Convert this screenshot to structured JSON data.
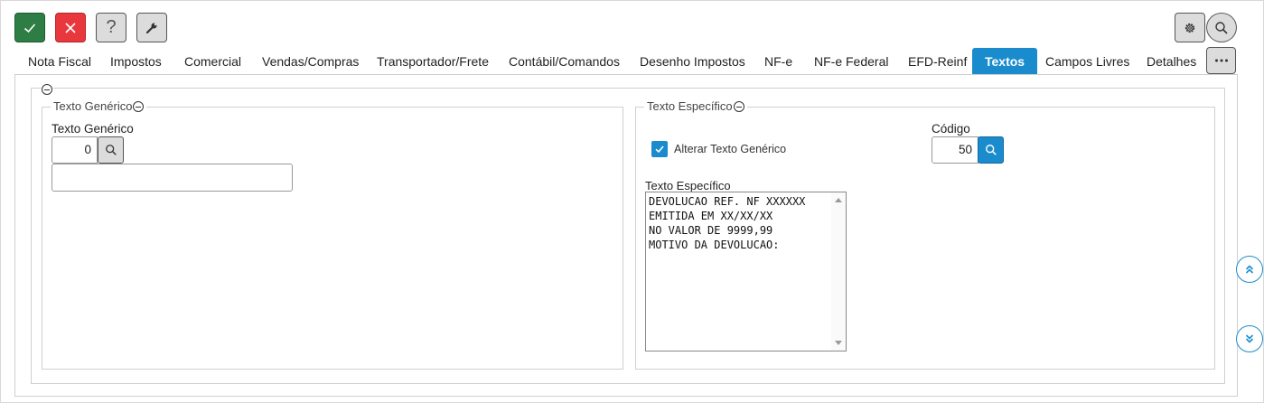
{
  "toolbar": {
    "confirm_icon": "check-icon",
    "cancel_icon": "close-icon",
    "help_label": "?",
    "tools_icon": "wrench-icon",
    "settings_icon": "gear-icon",
    "search_icon": "search-icon"
  },
  "tabs": [
    {
      "label": "Nota Fiscal",
      "active": false
    },
    {
      "label": "Impostos",
      "active": false
    },
    {
      "label": "Comercial",
      "active": false
    },
    {
      "label": "Vendas/Compras",
      "active": false
    },
    {
      "label": "Transportador/Frete",
      "active": false
    },
    {
      "label": "Contábil/Comandos",
      "active": false
    },
    {
      "label": "Desenho Impostos",
      "active": false
    },
    {
      "label": "NF-e",
      "active": false
    },
    {
      "label": "NF-e Federal",
      "active": false
    },
    {
      "label": "EFD-Reinf",
      "active": false
    },
    {
      "label": "Textos",
      "active": true
    },
    {
      "label": "Campos Livres",
      "active": false
    },
    {
      "label": "Detalhes",
      "active": false
    }
  ],
  "tab_more_icon": "more-horizontal-icon",
  "generic": {
    "legend": "Texto Genérico",
    "field_label": "Texto Genérico",
    "code_value": "0",
    "description_value": ""
  },
  "specific": {
    "legend": "Texto Específico",
    "checkbox_label": "Alterar Texto Genérico",
    "checkbox_checked": true,
    "code_label": "Código",
    "code_value": "50",
    "text_label": "Texto Específico",
    "text_lines": [
      "DEVOLUCAO REF. NF XXXXXX",
      "EMITIDA EM XX/XX/XX",
      "NO VALOR DE 9999,99",
      "MOTIVO DA DEVOLUCAO:"
    ]
  },
  "side_nav": {
    "up_icon": "double-chevron-up-icon",
    "down_icon": "double-chevron-down-icon"
  },
  "colors": {
    "accent": "#1a8ccd",
    "confirm": "#2e7d45",
    "cancel": "#e8383d"
  }
}
